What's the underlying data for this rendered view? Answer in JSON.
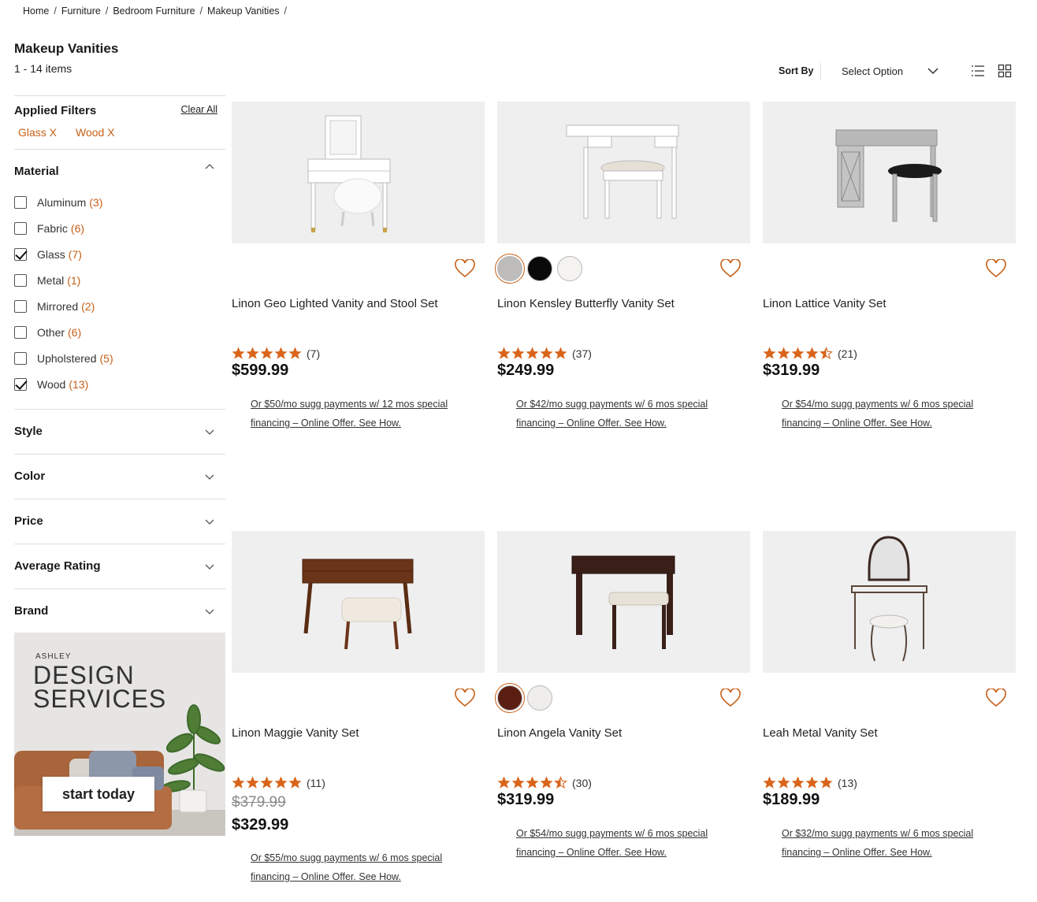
{
  "breadcrumb": [
    "Home",
    "Furniture",
    "Bedroom Furniture",
    "Makeup Vanities"
  ],
  "breadcrumb_sep": "/",
  "page": {
    "title": "Makeup Vanities",
    "count": "1 - 14 items"
  },
  "sort": {
    "label": "Sort By",
    "value": "Select Option"
  },
  "applied": {
    "title": "Applied Filters",
    "clear": "Clear All",
    "chips": [
      "Glass X",
      "Wood X"
    ]
  },
  "material": {
    "title": "Material",
    "options": [
      {
        "label": "Aluminum",
        "count": "(3)",
        "checked": false
      },
      {
        "label": "Fabric",
        "count": "(6)",
        "checked": false
      },
      {
        "label": "Glass",
        "count": "(7)",
        "checked": true
      },
      {
        "label": "Metal",
        "count": "(1)",
        "checked": false
      },
      {
        "label": "Mirrored",
        "count": "(2)",
        "checked": false
      },
      {
        "label": "Other",
        "count": "(6)",
        "checked": false
      },
      {
        "label": "Upholstered",
        "count": "(5)",
        "checked": false
      },
      {
        "label": "Wood",
        "count": "(13)",
        "checked": true
      }
    ]
  },
  "facets": [
    "Style",
    "Color",
    "Price",
    "Average Rating",
    "Brand"
  ],
  "ad": {
    "brand": "ASHLEY",
    "line1": "DESIGN",
    "line2": "SERVICES",
    "button": "start today"
  },
  "colors": {
    "accent": "#c65f17",
    "star": "#d9651b"
  },
  "products": [
    {
      "name": "Linon Geo Lighted Vanity and Stool Set",
      "rating": 5,
      "reviews": "(7)",
      "was": "",
      "price": "$599.99",
      "finance": "Or $50/mo sugg payments w/ 12 mos special financing – Online Offer. See How.",
      "swatches": []
    },
    {
      "name": "Linon Kensley Butterfly Vanity Set",
      "rating": 5,
      "reviews": "(37)",
      "was": "",
      "price": "$249.99",
      "finance": "Or $42/mo sugg payments w/ 6 mos special financing – Online Offer. See How.",
      "swatches": [
        "#bdbcbb",
        "#0a0a0a",
        "#f4f3f0"
      ]
    },
    {
      "name": "Linon Lattice Vanity Set",
      "rating": 4.5,
      "reviews": "(21)",
      "was": "",
      "price": "$319.99",
      "finance": "Or $54/mo sugg payments w/ 6 mos special financing – Online Offer. See How.",
      "swatches": []
    },
    {
      "name": "Linon Maggie Vanity Set",
      "rating": 5,
      "reviews": "(11)",
      "was": "$379.99",
      "price": "$329.99",
      "finance": "Or $55/mo sugg payments w/ 6 mos special financing – Online Offer. See How.",
      "swatches": []
    },
    {
      "name": "Linon Angela Vanity Set",
      "rating": 4.5,
      "reviews": "(30)",
      "was": "",
      "price": "$319.99",
      "finance": "Or $54/mo sugg payments w/ 6 mos special financing – Online Offer. See How.",
      "swatches": [
        "#5a1f12",
        "#efeeeb"
      ]
    },
    {
      "name": "Leah Metal Vanity Set",
      "rating": 5,
      "reviews": "(13)",
      "was": "",
      "price": "$189.99",
      "finance": "Or $32/mo sugg payments w/ 6 mos special financing – Online Offer. See How.",
      "swatches": []
    }
  ]
}
